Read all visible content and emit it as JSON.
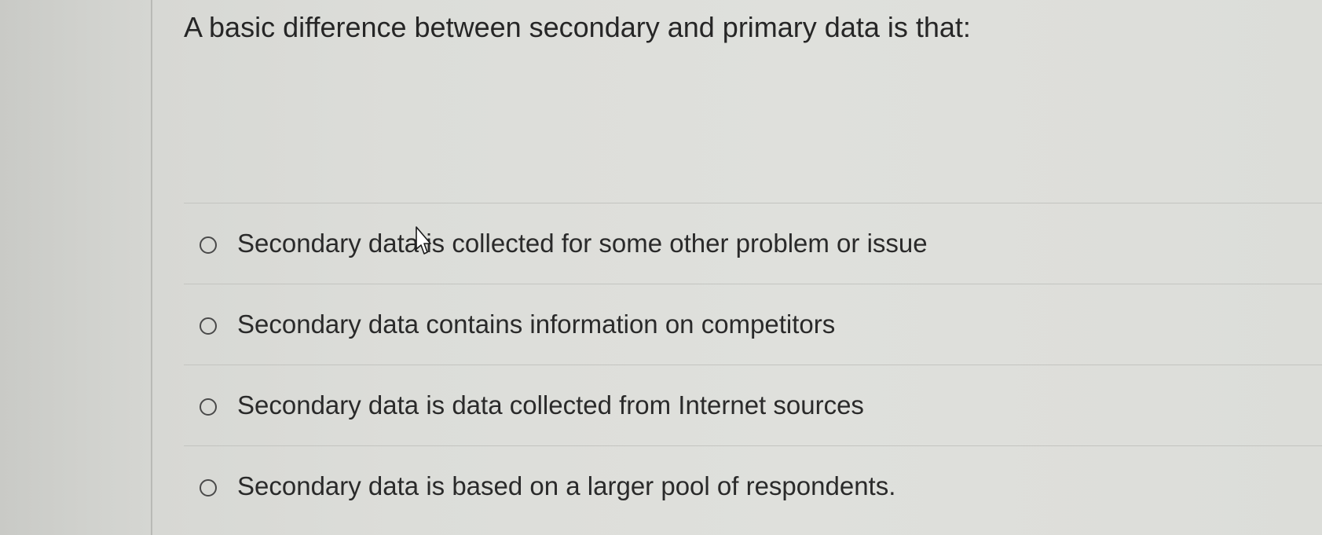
{
  "question": {
    "text": "A basic difference between secondary and primary data is that:"
  },
  "options": [
    {
      "label": "Secondary data is collected for some other problem or issue",
      "selected": false
    },
    {
      "label": "Secondary data contains information on competitors",
      "selected": false
    },
    {
      "label": "Secondary data is data collected from Internet sources",
      "selected": false
    },
    {
      "label": "Secondary data is based on a larger pool of respondents.",
      "selected": false
    }
  ],
  "icons": {
    "cursor": "hand-pointer-cursor",
    "radio": "radio-unselected"
  },
  "colors": {
    "text": "#2a2a2a",
    "divider": "#c3c4c0",
    "background": "#dcddd9"
  }
}
